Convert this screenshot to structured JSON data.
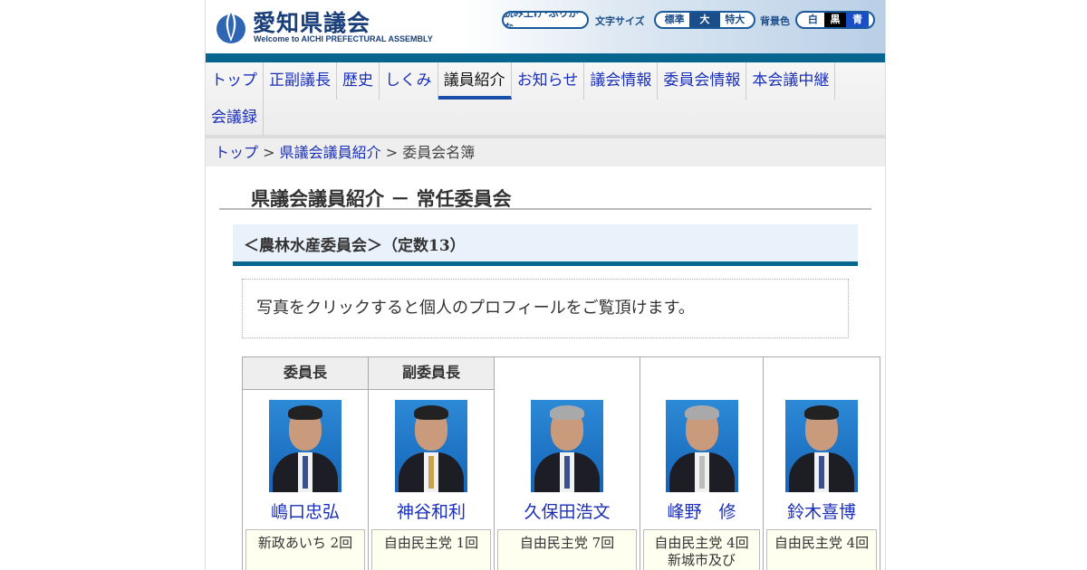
{
  "header": {
    "site_title": "愛知県議会",
    "site_subtitle": "Welcome to AICHI PREFECTURAL ASSEMBLY",
    "read_aloud": "読み上げ･ふりがな",
    "font_size_label": "文字サイズ",
    "font_sizes": [
      "標準",
      "大",
      "特大"
    ],
    "bg_label": "背景色",
    "bg_colors": [
      "白",
      "黒",
      "青"
    ]
  },
  "nav": {
    "items": [
      "トップ",
      "正副議長",
      "歴史",
      "しくみ",
      "議員紹介",
      "お知らせ",
      "議会情報",
      "委員会情報",
      "本会議中継",
      "会議録"
    ],
    "active": "議員紹介"
  },
  "breadcrumb": {
    "home": "トップ",
    "sep1": ">",
    "members": "県議会議員紹介",
    "sep2": ">",
    "current": "委員会名簿"
  },
  "page_heading": "県議会議員紹介 － 常任委員会",
  "committee": {
    "title": "＜農林水産委員会＞（定数13）",
    "notice": "写真をクリックすると個人のプロフィールをご覧頂けます。",
    "members": [
      {
        "role": "委員長",
        "name": "嶋口忠弘",
        "party": "新政あいち 2回"
      },
      {
        "role": "副委員長",
        "name": "神谷和利",
        "party": "自由民主党 1回"
      },
      {
        "role": "",
        "name": "久保田浩文",
        "party": "自由民主党 7回"
      },
      {
        "role": "",
        "name": "峰野　修",
        "party": "自由民主党 4回",
        "district": "新城市及び"
      },
      {
        "role": "",
        "name": "鈴木喜博",
        "party": "自由民主党 4回"
      }
    ]
  },
  "colors": {
    "header_bar": "#07668f",
    "link": "#1a2fb8",
    "photo_bg": "#1565b8"
  }
}
